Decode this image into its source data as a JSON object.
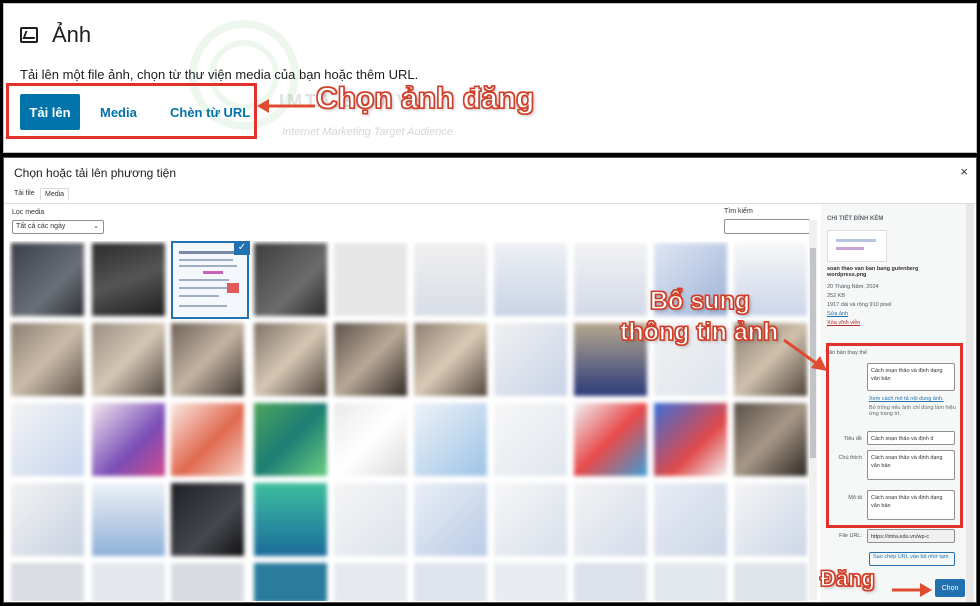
{
  "block": {
    "title": "Ảnh",
    "description": "Tải lên một file ảnh, chọn từ thư viện media của bạn hoặc thêm URL.",
    "btn_upload": "Tải lên",
    "btn_media": "Media",
    "btn_url": "Chèn từ URL",
    "watermark": "IMTA.EDU.VN",
    "watermark_sub": "Internet Marketing Target Audience"
  },
  "annotations": {
    "choose": "Chọn ảnh đăng",
    "supplement_1": "Bổ sung",
    "supplement_2": "thông tin ảnh",
    "publish": "Đăng"
  },
  "modal": {
    "title": "Chọn hoặc tải lên phương tiện",
    "close": "×",
    "tab_upload": "Tải file",
    "tab_media": "Media",
    "filter_label": "Lọc media",
    "filter_value": "Tất cả các ngày",
    "search_label": "Tìm kiếm",
    "check": "✓"
  },
  "details": {
    "heading": "CHI TIẾT ĐÍNH KÈM",
    "filename": "soan thao van ban bang gutenberg wordpress.png",
    "date": "20 Tháng Năm, 2024",
    "size": "252 KB",
    "dimensions": "1917 dài và rộng 910 pixel",
    "edit_link": "Sửa ảnh",
    "delete_link": "Xóa vĩnh viễn",
    "alt_label": "Văn bản thay thế",
    "alt_value": "Cách soạn thảo và định dạng văn bản",
    "alt_help_link": "Xem cách mô tả nội dung ảnh.",
    "alt_help": "Bỏ trống nếu ảnh chỉ dùng làm hiệu ứng trang trí.",
    "title_label": "Tiêu đề",
    "title_value": "Cách soạn thảo và định d",
    "caption_label": "Chú thích",
    "caption_value": "Cách soạn thảo và định dạng văn bản",
    "desc_label": "Mô tả",
    "desc_value": "Cách soạn thảo và định dạng văn bản",
    "url_label": "File URL:",
    "url_value": "https://imta.edu.vn/wp-c",
    "copy_btn": "Sao chép URL vào bộ nhớ tạm",
    "select_btn": "Chọn"
  },
  "colors": {
    "accent": "#0073aa",
    "annotation": "#e0312b",
    "selection": "#2271b1"
  }
}
